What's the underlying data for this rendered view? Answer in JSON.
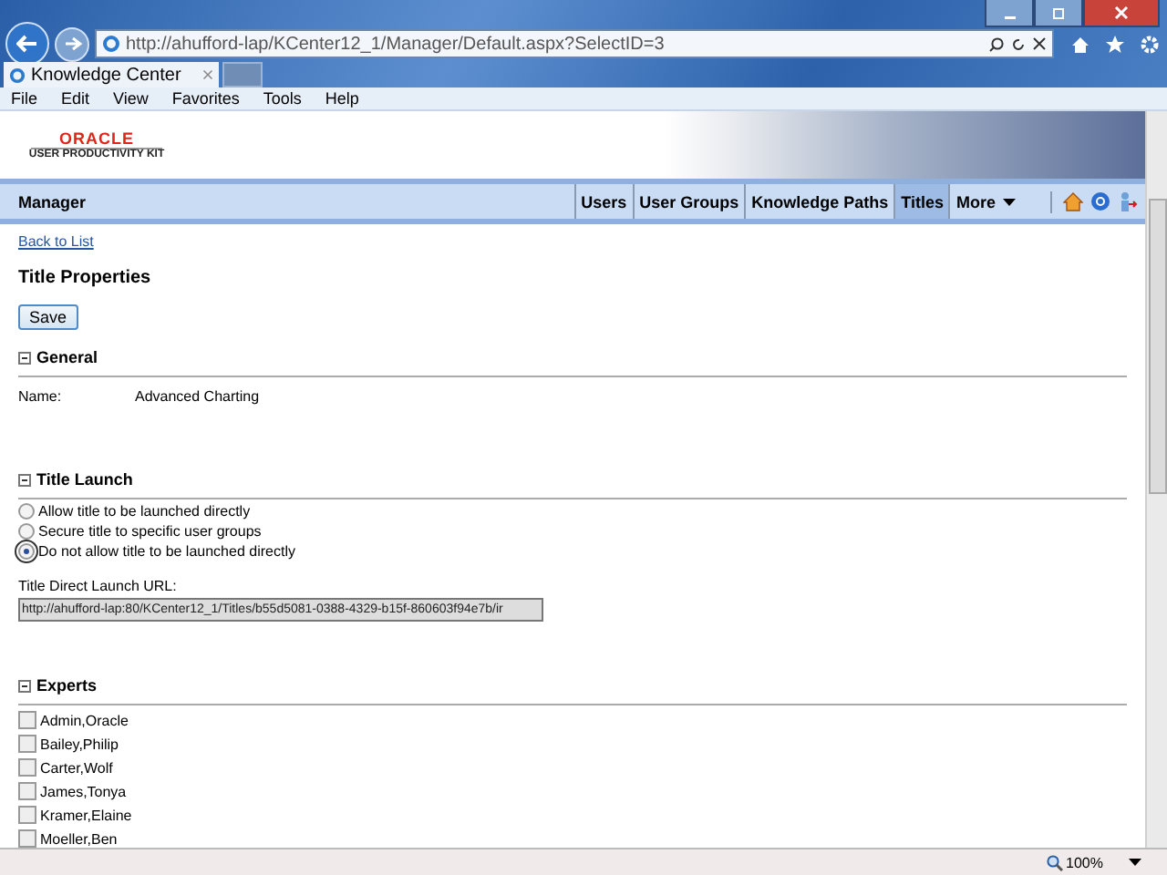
{
  "browser": {
    "url": "http://ahufford-lap/KCenter12_1/Manager/Default.aspx?SelectID=3",
    "tab": "Knowledge Center",
    "menu": [
      "File",
      "Edit",
      "View",
      "Favorites",
      "Tools",
      "Help"
    ],
    "zoom": "100%"
  },
  "header": {
    "logo": "ORACLE",
    "logo_sub": "USER PRODUCTIVITY KIT"
  },
  "nav": {
    "title": "Manager",
    "items": [
      {
        "label": "Users",
        "selected": false
      },
      {
        "label": "User Groups",
        "selected": false
      },
      {
        "label": "Knowledge Paths",
        "selected": false
      },
      {
        "label": "Titles",
        "selected": true
      },
      {
        "label": "More",
        "selected": false
      }
    ]
  },
  "back_link": "Back to List",
  "heading": "Title Properties",
  "save": "Save",
  "general": {
    "title": "General",
    "expanded": true,
    "name_label": "Name:",
    "name_value": "Advanced Charting"
  },
  "launch": {
    "title": "Title Launch",
    "expanded": true,
    "options": [
      {
        "label": "Allow title to be launched directly",
        "selected": false
      },
      {
        "label": "Secure title to specific user groups",
        "selected": false
      },
      {
        "label": "Do not allow title to be launched directly",
        "selected": true
      }
    ],
    "url_label": "Title Direct Launch URL:",
    "url_value": "http://ahufford-lap:80/KCenter12_1/Titles/b55d5081-0388-4329-b15f-860603f94e7b/ir"
  },
  "experts": {
    "title": "Experts",
    "expanded": true,
    "items": [
      {
        "label": "Admin,Oracle",
        "checked": false
      },
      {
        "label": "Bailey,Philip",
        "checked": false
      },
      {
        "label": "Carter,Wolf",
        "checked": false
      },
      {
        "label": "James,Tonya",
        "checked": false
      },
      {
        "label": "Kramer,Elaine",
        "checked": false
      },
      {
        "label": "Moeller,Ben",
        "checked": false
      }
    ]
  }
}
